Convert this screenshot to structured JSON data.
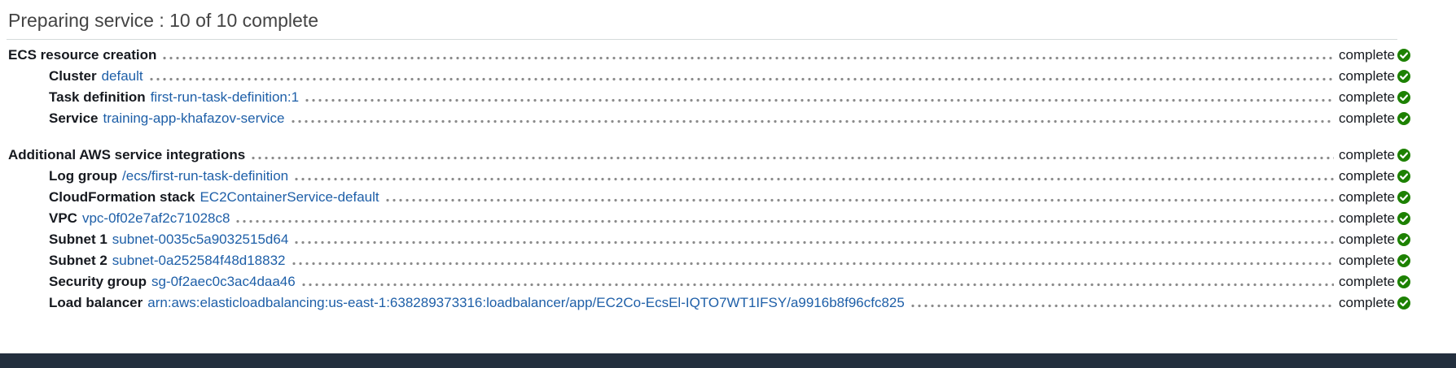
{
  "heading": "Preparing service : 10 of 10 complete",
  "sections": [
    {
      "label": "ECS resource creation",
      "status": "complete",
      "items": [
        {
          "label": "Cluster",
          "value": "default",
          "status": "complete"
        },
        {
          "label": "Task definition",
          "value": "first-run-task-definition:1",
          "status": "complete"
        },
        {
          "label": "Service",
          "value": "training-app-khafazov-service",
          "status": "complete"
        }
      ]
    },
    {
      "label": "Additional AWS service integrations",
      "status": "complete",
      "items": [
        {
          "label": "Log group",
          "value": "/ecs/first-run-task-definition",
          "status": "complete"
        },
        {
          "label": "CloudFormation stack",
          "value": "EC2ContainerService-default",
          "status": "complete"
        },
        {
          "label": "VPC",
          "value": "vpc-0f02e7af2c71028c8",
          "status": "complete"
        },
        {
          "label": "Subnet 1",
          "value": "subnet-0035c5a9032515d64",
          "status": "complete"
        },
        {
          "label": "Subnet 2",
          "value": "subnet-0a252584f48d18832",
          "status": "complete"
        },
        {
          "label": "Security group",
          "value": "sg-0f2aec0c3ac4daa46",
          "status": "complete"
        },
        {
          "label": "Load balancer",
          "value": "arn:aws:elasticloadbalancing:us-east-1:638289373316:loadbalancer/app/EC2Co-EcsEl-IQTO7WT1IFSY/a9916b8f96cfc825",
          "status": "complete"
        }
      ]
    }
  ],
  "colors": {
    "link": "#1e5fa8",
    "success": "#1d8102",
    "footer": "#232f3e"
  },
  "icons": {
    "status": "check-circle-icon"
  }
}
